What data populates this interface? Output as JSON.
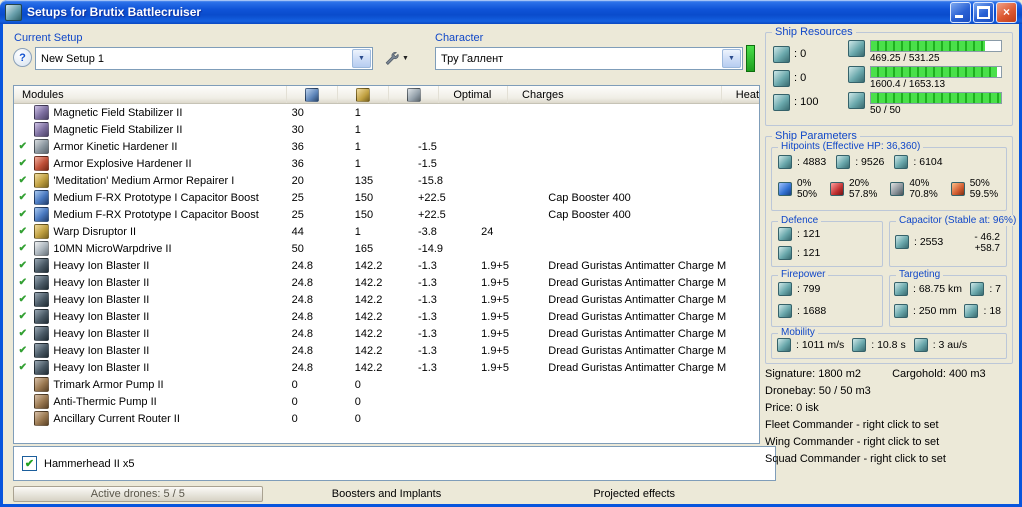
{
  "window": {
    "title": "Setups for Brutix Battlecruiser"
  },
  "toolbar": {
    "current_setup_label": "Current Setup",
    "setup_value": "New Setup 1",
    "character_label": "Character",
    "character_value": "Тру Галлент"
  },
  "table": {
    "columns": {
      "modules": "Modules",
      "optimal": "Optimal",
      "charges": "Charges",
      "heat": "Heat"
    },
    "rows": [
      {
        "fitted": false,
        "icon": "magnetic-field-stabilizer-icon",
        "style": "purple",
        "name": "Magnetic Field Stabilizer II",
        "cpu": "30",
        "pg": "1",
        "cap": "",
        "optimal": "",
        "charges": "",
        "heat": ""
      },
      {
        "fitted": false,
        "icon": "magnetic-field-stabilizer-icon",
        "style": "purple",
        "name": "Magnetic Field Stabilizer II",
        "cpu": "30",
        "pg": "1",
        "cap": "",
        "optimal": "",
        "charges": "",
        "heat": ""
      },
      {
        "fitted": true,
        "icon": "armor-hardener-icon",
        "style": "gray",
        "name": "Armor Kinetic Hardener II",
        "cpu": "36",
        "pg": "1",
        "cap": "-1.5",
        "optimal": "",
        "charges": "",
        "heat": ""
      },
      {
        "fitted": true,
        "icon": "armor-hardener-icon",
        "style": "red",
        "name": "Armor Explosive Hardener II",
        "cpu": "36",
        "pg": "1",
        "cap": "-1.5",
        "optimal": "",
        "charges": "",
        "heat": ""
      },
      {
        "fitted": true,
        "icon": "armor-repairer-icon",
        "style": "gold",
        "name": "'Meditation' Medium Armor Repairer I",
        "cpu": "20",
        "pg": "135",
        "cap": "-15.8",
        "optimal": "",
        "charges": "",
        "heat": ""
      },
      {
        "fitted": true,
        "icon": "capacitor-booster-icon",
        "style": "blue",
        "name": "Medium F-RX Prototype I Capacitor Boost",
        "cpu": "25",
        "pg": "150",
        "cap": "+22.5",
        "optimal": "",
        "charges": "Cap Booster 400",
        "heat": ""
      },
      {
        "fitted": true,
        "icon": "capacitor-booster-icon",
        "style": "blue",
        "name": "Medium F-RX Prototype I Capacitor Boost",
        "cpu": "25",
        "pg": "150",
        "cap": "+22.5",
        "optimal": "",
        "charges": "Cap Booster 400",
        "heat": ""
      },
      {
        "fitted": true,
        "icon": "warp-disruptor-icon",
        "style": "gold",
        "name": "Warp Disruptor II",
        "cpu": "44",
        "pg": "1",
        "cap": "-3.8",
        "optimal": "24",
        "charges": "",
        "heat": ""
      },
      {
        "fitted": true,
        "icon": "microwarpdrive-icon",
        "style": "silver",
        "name": "10MN MicroWarpdrive II",
        "cpu": "50",
        "pg": "165",
        "cap": "-14.9",
        "optimal": "",
        "charges": "",
        "heat": ""
      },
      {
        "fitted": true,
        "icon": "hybrid-turret-icon",
        "style": "dark",
        "name": "Heavy Ion Blaster II",
        "cpu": "24.8",
        "pg": "142.2",
        "cap": "-1.3",
        "optimal": "1.9+5",
        "charges": "Dread Guristas Antimatter Charge M",
        "heat": ""
      },
      {
        "fitted": true,
        "icon": "hybrid-turret-icon",
        "style": "dark",
        "name": "Heavy Ion Blaster II",
        "cpu": "24.8",
        "pg": "142.2",
        "cap": "-1.3",
        "optimal": "1.9+5",
        "charges": "Dread Guristas Antimatter Charge M",
        "heat": ""
      },
      {
        "fitted": true,
        "icon": "hybrid-turret-icon",
        "style": "dark",
        "name": "Heavy Ion Blaster II",
        "cpu": "24.8",
        "pg": "142.2",
        "cap": "-1.3",
        "optimal": "1.9+5",
        "charges": "Dread Guristas Antimatter Charge M",
        "heat": ""
      },
      {
        "fitted": true,
        "icon": "hybrid-turret-icon",
        "style": "dark",
        "name": "Heavy Ion Blaster II",
        "cpu": "24.8",
        "pg": "142.2",
        "cap": "-1.3",
        "optimal": "1.9+5",
        "charges": "Dread Guristas Antimatter Charge M",
        "heat": ""
      },
      {
        "fitted": true,
        "icon": "hybrid-turret-icon",
        "style": "dark",
        "name": "Heavy Ion Blaster II",
        "cpu": "24.8",
        "pg": "142.2",
        "cap": "-1.3",
        "optimal": "1.9+5",
        "charges": "Dread Guristas Antimatter Charge M",
        "heat": ""
      },
      {
        "fitted": true,
        "icon": "hybrid-turret-icon",
        "style": "dark",
        "name": "Heavy Ion Blaster II",
        "cpu": "24.8",
        "pg": "142.2",
        "cap": "-1.3",
        "optimal": "1.9+5",
        "charges": "Dread Guristas Antimatter Charge M",
        "heat": ""
      },
      {
        "fitted": true,
        "icon": "hybrid-turret-icon",
        "style": "dark",
        "name": "Heavy Ion Blaster II",
        "cpu": "24.8",
        "pg": "142.2",
        "cap": "-1.3",
        "optimal": "1.9+5",
        "charges": "Dread Guristas Antimatter Charge M",
        "heat": ""
      },
      {
        "fitted": false,
        "icon": "rig-armor-icon",
        "style": "brown",
        "name": "Trimark Armor Pump II",
        "cpu": "0",
        "pg": "0",
        "cap": "",
        "optimal": "",
        "charges": "",
        "heat": ""
      },
      {
        "fitted": false,
        "icon": "rig-armor-icon",
        "style": "brown",
        "name": "Anti-Thermic Pump II",
        "cpu": "0",
        "pg": "0",
        "cap": "",
        "optimal": "",
        "charges": "",
        "heat": ""
      },
      {
        "fitted": false,
        "icon": "rig-engineering-icon",
        "style": "brown",
        "name": "Ancillary Current Router II",
        "cpu": "0",
        "pg": "0",
        "cap": "",
        "optimal": "",
        "charges": "",
        "heat": ""
      }
    ]
  },
  "drones": {
    "checked": true,
    "label": "Hammerhead II x5"
  },
  "bottom": {
    "active_drones": "Active drones: 5 / 5",
    "boosters": "Boosters and Implants",
    "projected": "Projected effects"
  },
  "resources": {
    "title": "Ship Resources",
    "turrets": ": 0",
    "launchers": ": 0",
    "calibration": ": 100",
    "cpu": {
      "text": "469.25 / 531.25",
      "pct": 88
    },
    "powergrid": {
      "text": "1600.4 / 1653.13",
      "pct": 97
    },
    "dronebay": {
      "text": "50 / 50",
      "pct": 100
    }
  },
  "parameters": {
    "title": "Ship Parameters",
    "hitpoints": {
      "title": "Hitpoints (Effective HP: 36,360)",
      "shield": ": 4883",
      "armor": ": 9526",
      "structure": ": 6104",
      "resists": [
        {
          "top": "0%",
          "bottom": "50%"
        },
        {
          "top": "20%",
          "bottom": "57.8%"
        },
        {
          "top": "40%",
          "bottom": "70.8%"
        },
        {
          "top": "50%",
          "bottom": "59.5%"
        }
      ]
    },
    "defence": {
      "title": "Defence",
      "value1": ": 121",
      "value2": ": 121"
    },
    "capacitor": {
      "title": "Capacitor (Stable at: 96%)",
      "amount": ": 2553",
      "drain": "- 46.2",
      "recharge": "+58.7"
    },
    "firepower": {
      "title": "Firepower",
      "dps": ": 799",
      "volley": ": 1688"
    },
    "targeting": {
      "title": "Targeting",
      "range": ": 68.75 km",
      "max_targets": ": 7",
      "scan_resolution": ": 250 mm",
      "sensor_strength": ": 18"
    },
    "mobility": {
      "title": "Mobility",
      "speed": ": 1011 m/s",
      "align": ": 10.8 s",
      "warp": ": 3 au/s"
    }
  },
  "footer": {
    "signature": "Signature: 1800 m2",
    "cargohold": "Cargohold: 400 m3",
    "dronebay": "Dronebay: 50 / 50 m3",
    "price": "Price: 0 isk",
    "fleet": "Fleet Commander - right click to set",
    "wing": "Wing Commander - right click to set",
    "squad": "Squad Commander - right click to set"
  }
}
